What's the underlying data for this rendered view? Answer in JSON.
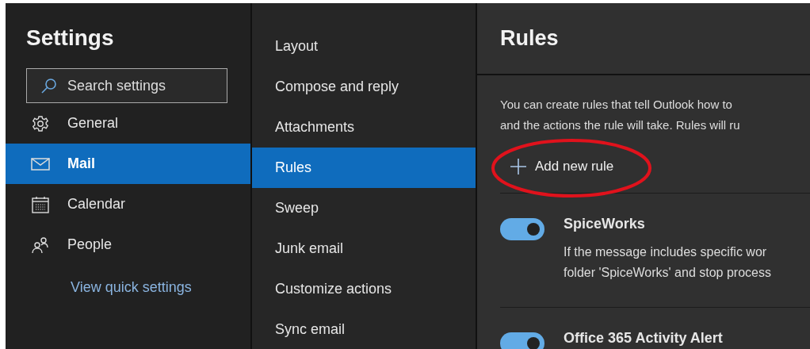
{
  "settings_panel": {
    "title": "Settings",
    "search": {
      "placeholder": "Search settings"
    },
    "nav": [
      {
        "label": "General",
        "kind": "gear",
        "selected": false
      },
      {
        "label": "Mail",
        "kind": "mail",
        "selected": true
      },
      {
        "label": "Calendar",
        "kind": "calendar",
        "selected": false
      },
      {
        "label": "People",
        "kind": "people",
        "selected": false
      }
    ],
    "quick_settings_link": "View quick settings"
  },
  "mail_menu": [
    {
      "label": "Layout",
      "selected": false
    },
    {
      "label": "Compose and reply",
      "selected": false
    },
    {
      "label": "Attachments",
      "selected": false
    },
    {
      "label": "Rules",
      "selected": true
    },
    {
      "label": "Sweep",
      "selected": false
    },
    {
      "label": "Junk email",
      "selected": false
    },
    {
      "label": "Customize actions",
      "selected": false
    },
    {
      "label": "Sync email",
      "selected": false
    }
  ],
  "rules": {
    "title": "Rules",
    "intro_lines": [
      "You can create rules that tell Outlook how to",
      "and the actions the rule will take. Rules will ru"
    ],
    "add_button": "Add new rule",
    "add_button_highlighted": true,
    "items": [
      {
        "name": "SpiceWorks",
        "on": true,
        "description_lines": [
          "If the message includes specific wor",
          "folder 'SpiceWorks' and stop process"
        ]
      },
      {
        "name": "Office 365 Activity Alert",
        "on": true
      }
    ]
  }
}
